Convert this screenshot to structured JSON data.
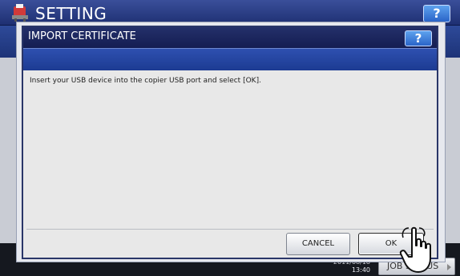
{
  "background": {
    "title": "SETTING",
    "help_label": "?",
    "date": "2011/08/18",
    "time": "13:40",
    "job_status_label": "JOB STATUS"
  },
  "dialog": {
    "title": "IMPORT CERTIFICATE",
    "help_label": "?",
    "message": "Insert your USB device into the copier USB port and select [OK].",
    "cancel_label": "CANCEL",
    "ok_label": "OK"
  },
  "colors": {
    "title_bar": "#1a245e",
    "band": "#2447a0",
    "help_button": "#3d7fdc",
    "dialog_body": "#e8e8e8"
  },
  "icons": {
    "logo": "setting-logo-icon",
    "pointer": "hand-pointer-icon"
  }
}
